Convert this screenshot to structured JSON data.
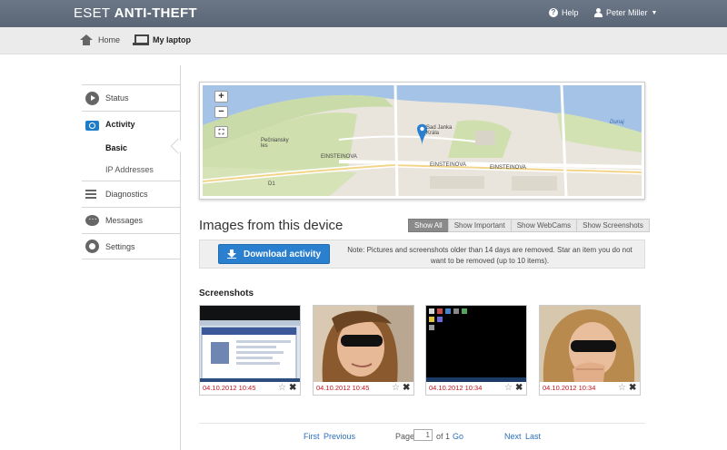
{
  "header": {
    "logo_light": "ESET",
    "logo_bold": "ANTI-THEFT",
    "help_label": "Help",
    "user_name": "Peter Miller"
  },
  "breadcrumb": {
    "home": "Home",
    "current": "My laptop"
  },
  "sidebar": {
    "items": [
      {
        "label": "Status",
        "icon": "play-circle-icon"
      },
      {
        "label": "Activity",
        "icon": "camera-icon",
        "active": true
      },
      {
        "label": "Diagnostics",
        "icon": "bars-icon"
      },
      {
        "label": "Messages",
        "icon": "chat-bubble-icon"
      },
      {
        "label": "Settings",
        "icon": "gear-icon"
      }
    ],
    "subitems": [
      {
        "label": "Basic",
        "active": true
      },
      {
        "label": "IP Addresses"
      }
    ]
  },
  "map": {
    "zoom_in": "+",
    "zoom_out": "−",
    "labels": {
      "place": "Sad Janka\nKrála",
      "forest": "Pečniansky\nles",
      "river": "Dunaj",
      "road_d1": "D1",
      "street": "EINSTEINOVA"
    }
  },
  "images": {
    "title": "Images from this device",
    "filters": [
      "Show All",
      "Show Important",
      "Show WebCams",
      "Show Screenshots"
    ],
    "active_filter": "Show All",
    "download_label": "Download activity",
    "note": "Note: Pictures and screenshots older than 14 days are removed. Star an item you do not want to be removed (up to 10 items).",
    "section": "Screenshots",
    "thumbnails": [
      {
        "date": "04.10.2012 10:45",
        "kind": "screenshot"
      },
      {
        "date": "04.10.2012 10:45",
        "kind": "webcam"
      },
      {
        "date": "04.10.2012 10:34",
        "kind": "screenshot"
      },
      {
        "date": "04.10.2012 10:34",
        "kind": "webcam"
      }
    ]
  },
  "pager": {
    "first": "First",
    "previous": "Previous",
    "page_label": "Page",
    "page_value": "1",
    "of_label": "of 1",
    "go": "Go",
    "next": "Next",
    "last": "Last"
  },
  "colors": {
    "topbar": "#5f6a7a",
    "accent": "#2a7fce",
    "date_red": "#c0141c"
  }
}
